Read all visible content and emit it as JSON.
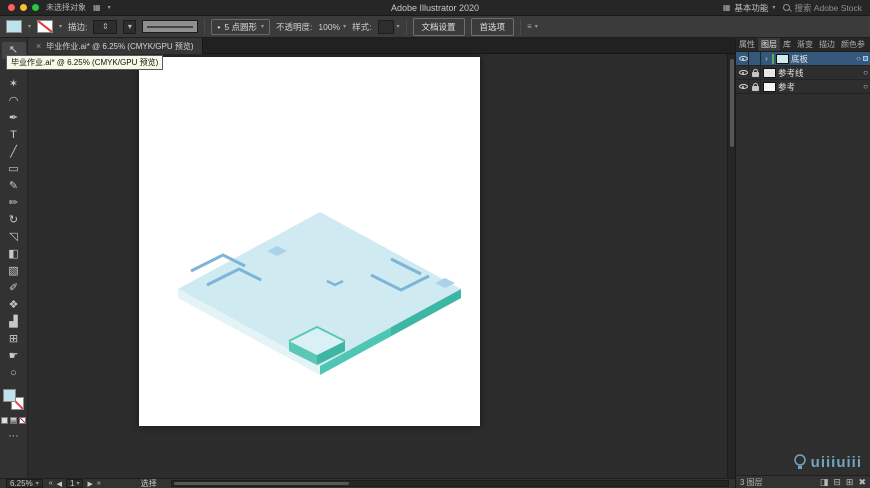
{
  "glyphs": {
    "caret": "▾",
    "menu": "≡",
    "stepper": "⇕",
    "home_grid": "▦",
    "workspace_icon": "▦"
  },
  "titlebar": {
    "selection_status": "未选择对象",
    "app_title": "Adobe Illustrator 2020",
    "workspace_label": "基本功能",
    "search_placeholder": "搜索 Adobe Stock"
  },
  "controlbar": {
    "stroke_label": "描边:",
    "brush_bullet": "•",
    "brush_name": "5 点圆形",
    "opacity_label": "不透明度:",
    "opacity_value": "100%",
    "style_label": "样式:",
    "doc_setup_label": "文档设置",
    "preferences_label": "首选项"
  },
  "document": {
    "tab_close": "×",
    "tab_title": "毕业作业.ai* @ 6.25% (CMYK/GPU 预览)",
    "tooltip_text": "毕业作业.ai* @ 6.25% (CMYK/GPU 预览)"
  },
  "tools": [
    {
      "name": "selection-tool",
      "glyph": "↖"
    },
    {
      "name": "direct-selection-tool",
      "glyph": "↖"
    },
    {
      "name": "magic-wand-tool",
      "glyph": "✶"
    },
    {
      "name": "lasso-tool",
      "glyph": "◠"
    },
    {
      "name": "pen-tool",
      "glyph": "✒"
    },
    {
      "name": "type-tool",
      "glyph": "T"
    },
    {
      "name": "line-segment-tool",
      "glyph": "╱"
    },
    {
      "name": "rectangle-tool",
      "glyph": "▭"
    },
    {
      "name": "paintbrush-tool",
      "glyph": "✎"
    },
    {
      "name": "pencil-tool",
      "glyph": "✏"
    },
    {
      "name": "rotate-tool",
      "glyph": "↻"
    },
    {
      "name": "scale-tool",
      "glyph": "◹"
    },
    {
      "name": "shape-builder-tool",
      "glyph": "◧"
    },
    {
      "name": "gradient-tool",
      "glyph": "▧"
    },
    {
      "name": "eyedropper-tool",
      "glyph": "✐"
    },
    {
      "name": "blend-tool",
      "glyph": "❖"
    },
    {
      "name": "graph-tool",
      "glyph": "▟"
    },
    {
      "name": "artboard-tool",
      "glyph": "⊞"
    },
    {
      "name": "hand-tool",
      "glyph": "☛"
    },
    {
      "name": "zoom-tool",
      "glyph": "○"
    }
  ],
  "toolbar_more": "⋯",
  "panel_tabs": [
    {
      "label": "属性"
    },
    {
      "label": "图层"
    },
    {
      "label": "库"
    },
    {
      "label": "渐变"
    },
    {
      "label": "描边"
    },
    {
      "label": "颜色参"
    }
  ],
  "layers": {
    "chevron": "›",
    "target_glyph": "○",
    "rows": [
      {
        "name": "底板"
      },
      {
        "name": "参考线"
      },
      {
        "name": "参考"
      }
    ],
    "footer_count": "3 图层",
    "footer_icons": [
      {
        "name": "make-mask",
        "glyph": "◨"
      },
      {
        "name": "new-sublayer",
        "glyph": "⊟"
      },
      {
        "name": "new-layer",
        "glyph": "⊞"
      },
      {
        "name": "delete-layer",
        "glyph": "✖"
      }
    ]
  },
  "statusbar": {
    "zoom": "6.25%",
    "first": "«",
    "prev": "◀",
    "artboard": "1",
    "next": "▶",
    "last": "»",
    "status": "选择"
  },
  "watermark": {
    "text": "uiiiuiii"
  },
  "swatches": {
    "fill": "#bfe3ea"
  },
  "artwork": {
    "top": "#cfeaf1",
    "left_edge": "#e4f3f6",
    "right_edge": "#4fc6b4",
    "right_edge_dark": "#3eb6a4",
    "accent": "#7db5d9",
    "accent_fill": "#a9d3e8",
    "step_top": "#d9f0f4",
    "step_stroke": "#5bc8b7"
  }
}
